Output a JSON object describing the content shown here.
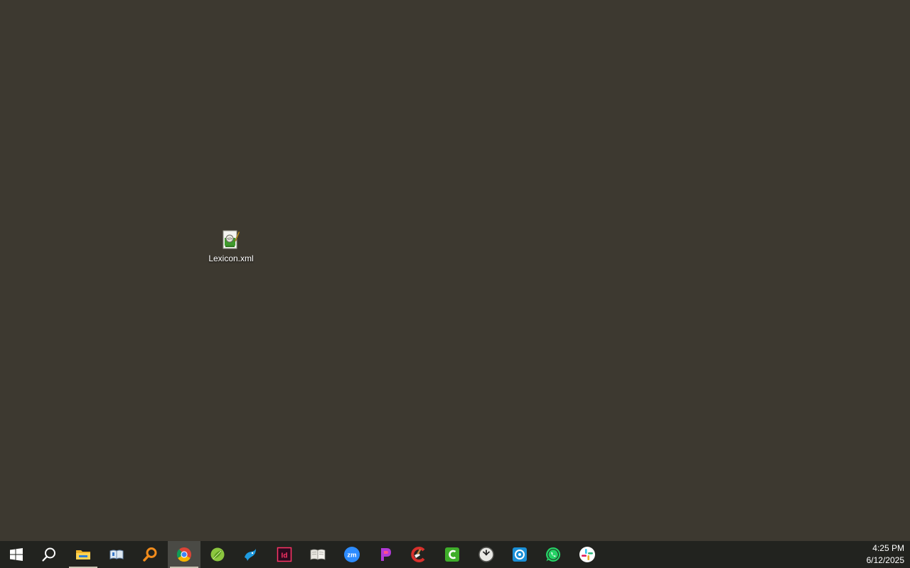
{
  "desktop": {
    "background": "#3d3930",
    "icons": [
      {
        "label": "Lexicon.xml",
        "icon": "xml-file-icon"
      }
    ]
  },
  "taskbar": {
    "background": "#22231f",
    "items": [
      {
        "name": "start-button",
        "icon": "windows-logo-icon"
      },
      {
        "name": "search-button",
        "icon": "search-icon"
      },
      {
        "name": "file-explorer",
        "icon": "folder-icon",
        "open": true
      },
      {
        "name": "app-book-blue",
        "icon": "book-icon"
      },
      {
        "name": "app-orange-search",
        "icon": "magnifier-orange-icon"
      },
      {
        "name": "chrome",
        "icon": "chrome-icon",
        "active": true,
        "open": true
      },
      {
        "name": "app-green-leaf",
        "icon": "green-leaf-icon"
      },
      {
        "name": "app-blue-bird",
        "icon": "blue-bird-icon"
      },
      {
        "name": "indesign",
        "icon": "indesign-icon",
        "text": "Id"
      },
      {
        "name": "app-open-book",
        "icon": "open-book-icon"
      },
      {
        "name": "zoom",
        "icon": "zoom-icon",
        "text": "zm"
      },
      {
        "name": "app-purple-p",
        "icon": "purple-p-icon"
      },
      {
        "name": "ccleaner",
        "icon": "ccleaner-icon"
      },
      {
        "name": "camtasia",
        "icon": "camtasia-icon"
      },
      {
        "name": "clock-app",
        "icon": "clock-icon"
      },
      {
        "name": "app-blue-circle",
        "icon": "blue-circle-icon"
      },
      {
        "name": "whatsapp",
        "icon": "whatsapp-icon"
      },
      {
        "name": "slack",
        "icon": "slack-icon"
      }
    ]
  },
  "clock": {
    "time": "4:25 PM",
    "date": "6/12/2025"
  }
}
